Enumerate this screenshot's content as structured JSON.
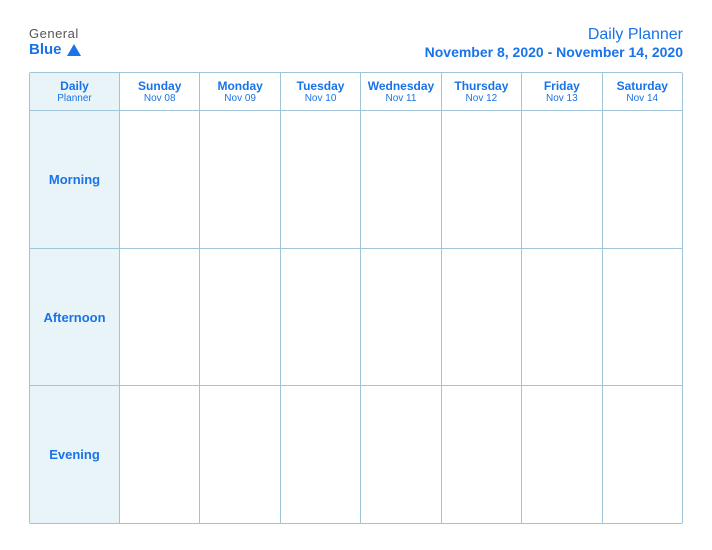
{
  "logo": {
    "general": "General",
    "blue": "Blue"
  },
  "header": {
    "title": "Daily Planner",
    "date_range": "November 8, 2020 - November 14, 2020"
  },
  "column_header": {
    "label_line1": "Daily",
    "label_line2": "Planner"
  },
  "days": [
    {
      "name": "Sunday",
      "date": "Nov 08"
    },
    {
      "name": "Monday",
      "date": "Nov 09"
    },
    {
      "name": "Tuesday",
      "date": "Nov 10"
    },
    {
      "name": "Wednesday",
      "date": "Nov 11"
    },
    {
      "name": "Thursday",
      "date": "Nov 12"
    },
    {
      "name": "Friday",
      "date": "Nov 13"
    },
    {
      "name": "Saturday",
      "date": "Nov 14"
    }
  ],
  "rows": [
    {
      "label": "Morning"
    },
    {
      "label": "Afternoon"
    },
    {
      "label": "Evening"
    }
  ]
}
